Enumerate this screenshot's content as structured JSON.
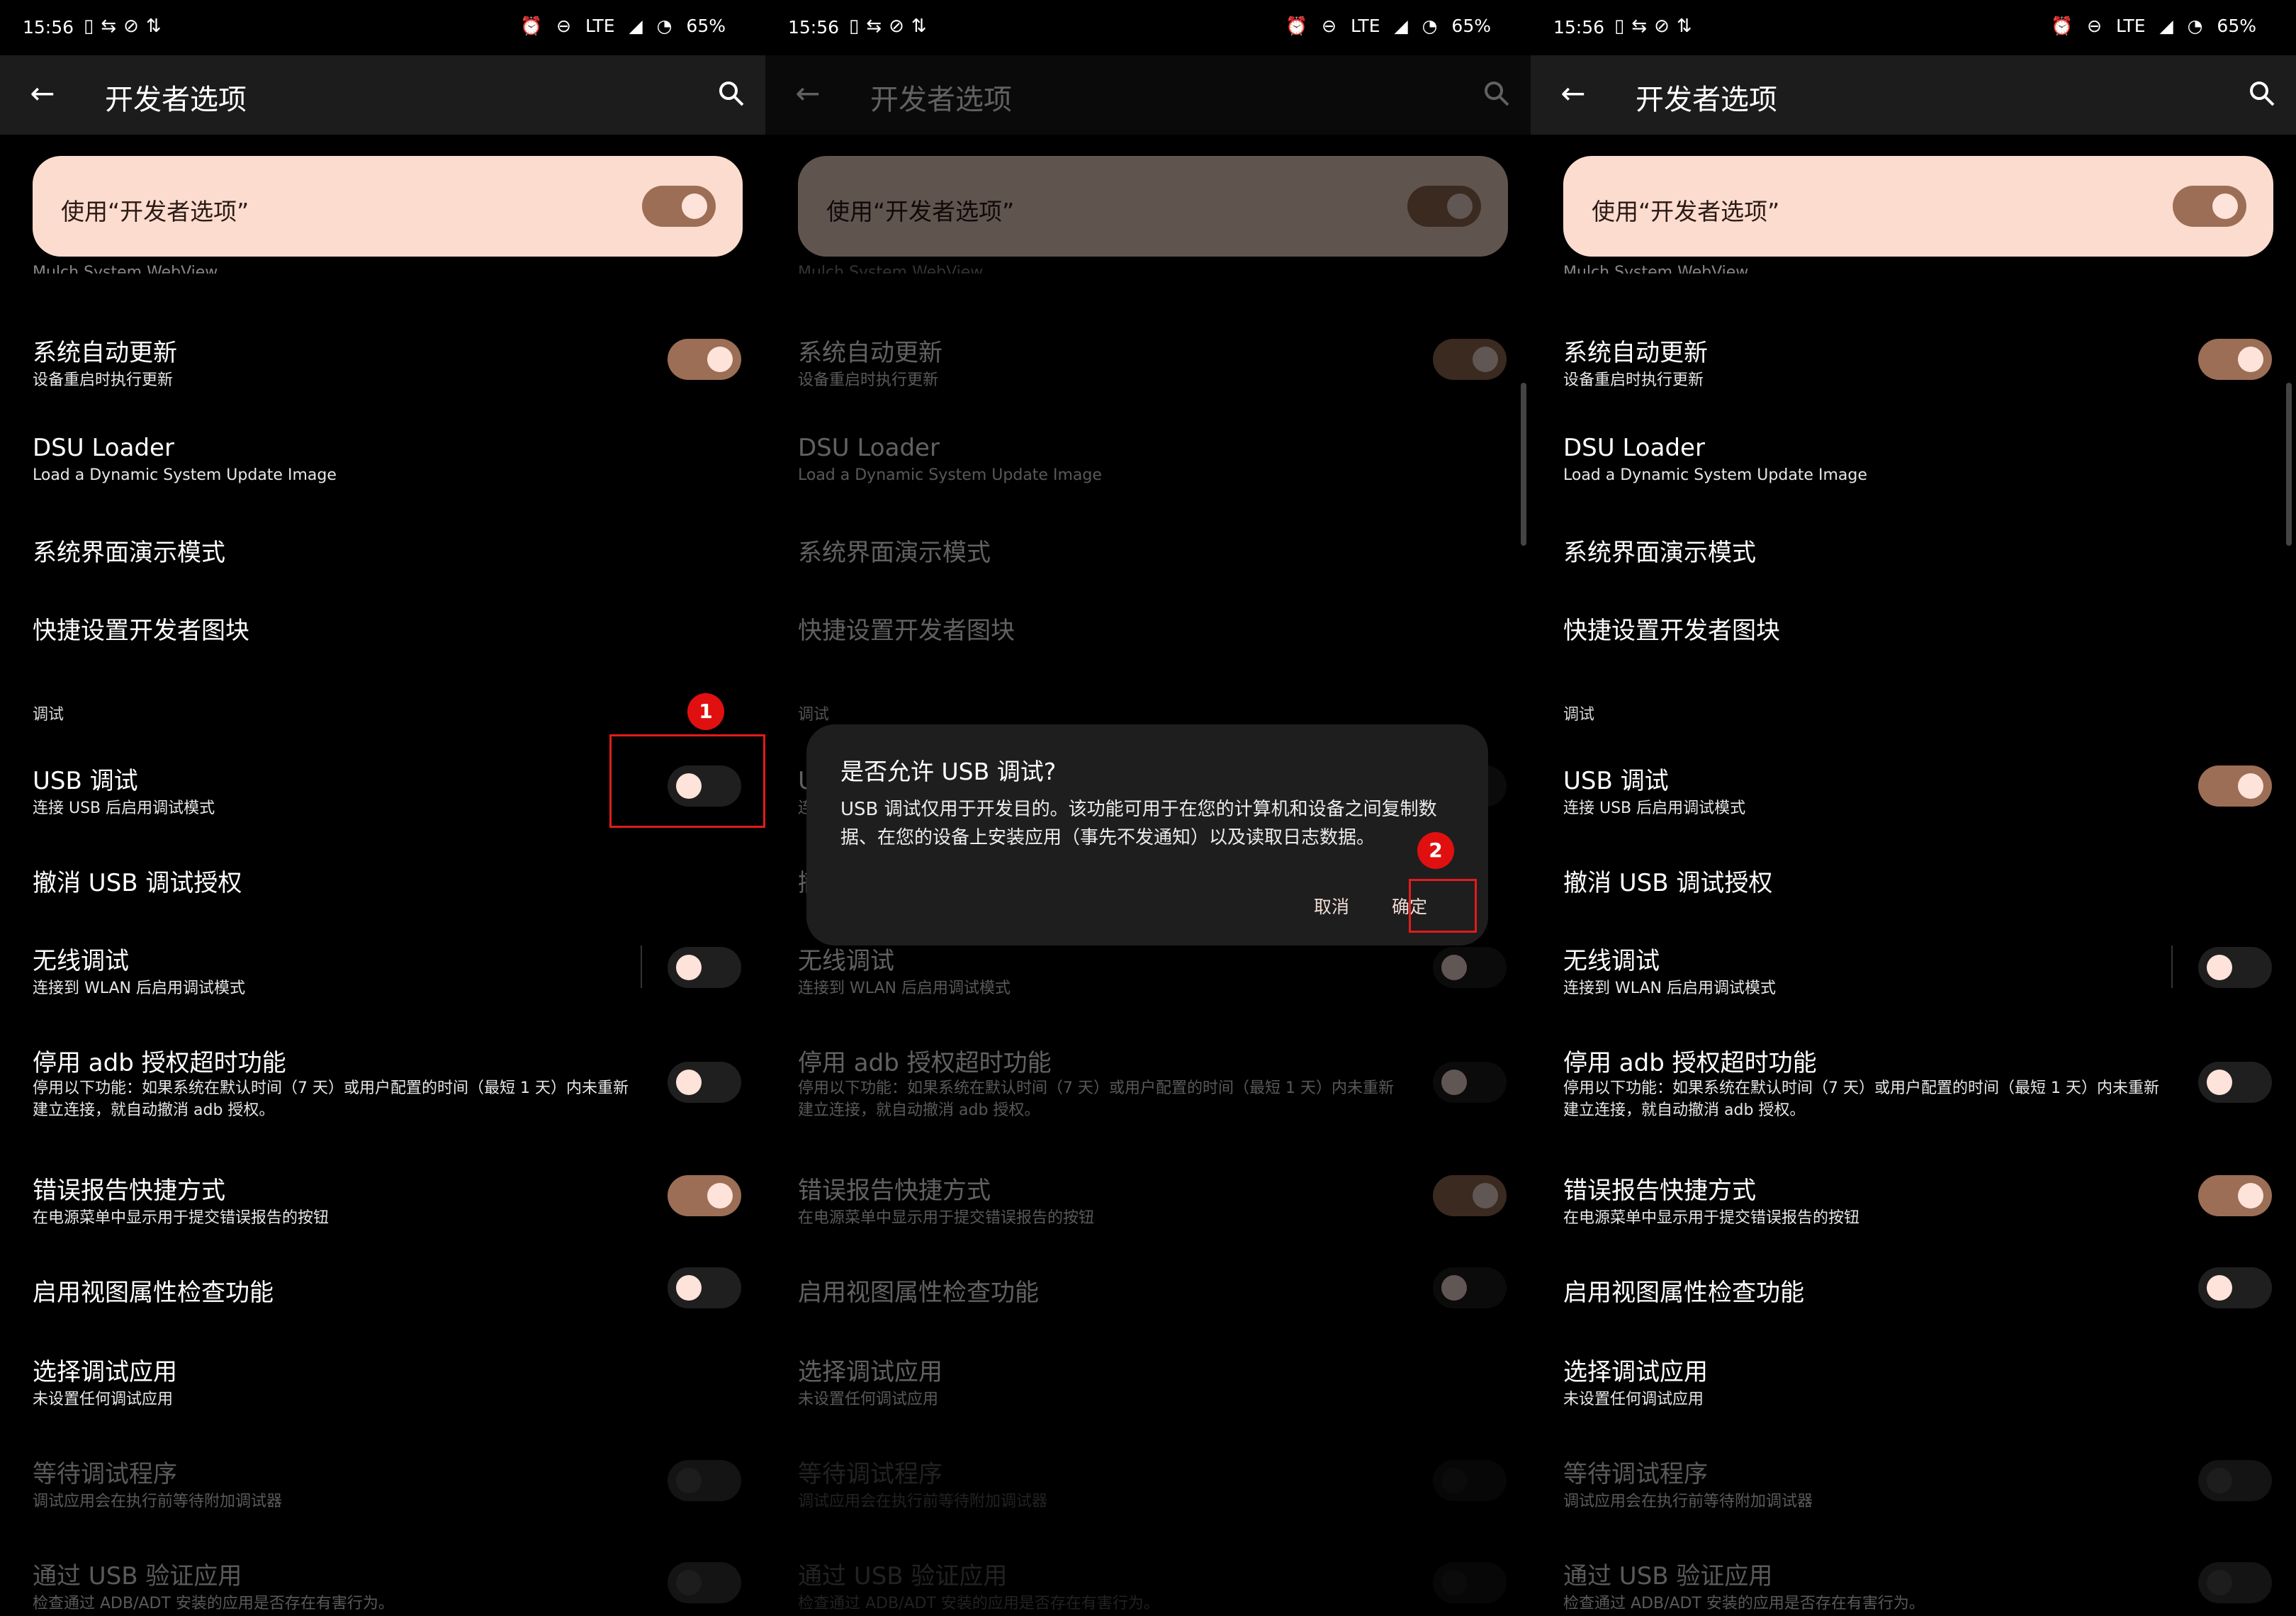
{
  "status_bar": {
    "time": "15:56",
    "network": "LTE",
    "battery": "65%"
  },
  "header": {
    "title": "开发者选项"
  },
  "master_toggle": {
    "label": "使用“开发者选项”",
    "state": "on"
  },
  "clipped_text": "Mulch System WebView",
  "rows": {
    "auto_update": {
      "title": "系统自动更新",
      "subtitle": "设备重启时执行更新"
    },
    "dsu_loader": {
      "title": "DSU Loader",
      "subtitle": "Load a Dynamic System Update Image"
    },
    "demo_mode": {
      "title": "系统界面演示模式"
    },
    "quick_tiles": {
      "title": "快捷设置开发者图块"
    },
    "section_debug": "调试",
    "usb_debug": {
      "title": "USB 调试",
      "subtitle": "连接 USB 后启用调试模式"
    },
    "revoke_usb": {
      "title": "撤消 USB 调试授权"
    },
    "wireless_debug": {
      "title": "无线调试",
      "subtitle": "连接到 WLAN 后启用调试模式"
    },
    "adb_timeout": {
      "title": "停用 adb 授权超时功能",
      "subtitle": "停用以下功能：如果系统在默认时间（7 天）或用户配置的时间（最短 1 天）内未重新建立连接，就自动撤消 adb 授权。"
    },
    "bugreport": {
      "title": "错误报告快捷方式",
      "subtitle": "在电源菜单中显示用于提交错误报告的按钮"
    },
    "view_attr": {
      "title": "启用视图属性检查功能"
    },
    "select_debug_app": {
      "title": "选择调试应用",
      "subtitle": "未设置任何调试应用"
    },
    "wait_debugger": {
      "title": "等待调试程序",
      "subtitle": "调试应用会在执行前等待附加调试器"
    },
    "verify_usb_apps": {
      "title": "通过 USB 验证应用",
      "subtitle": "检查通过 ADB/ADT 安装的应用是否存在有害行为。"
    }
  },
  "dialog": {
    "title": "是否允许 USB 调试?",
    "body": "USB 调试仅用于开发目的。该功能可用于在您的计算机和设备之间复制数据、在您的设备上安装应用（事先不发通知）以及读取日志数据。",
    "cancel": "取消",
    "ok": "确定"
  },
  "annotations": {
    "step1": "1",
    "step2": "2"
  },
  "colors": {
    "toggle_on": "#9c6e56",
    "master_bg": "#fddcd0",
    "annotation": "#e01010"
  },
  "panels": [
    {
      "usb_debug_state": "off",
      "dialog_open": false
    },
    {
      "usb_debug_state": "off",
      "dialog_open": true
    },
    {
      "usb_debug_state": "on",
      "dialog_open": false
    }
  ]
}
